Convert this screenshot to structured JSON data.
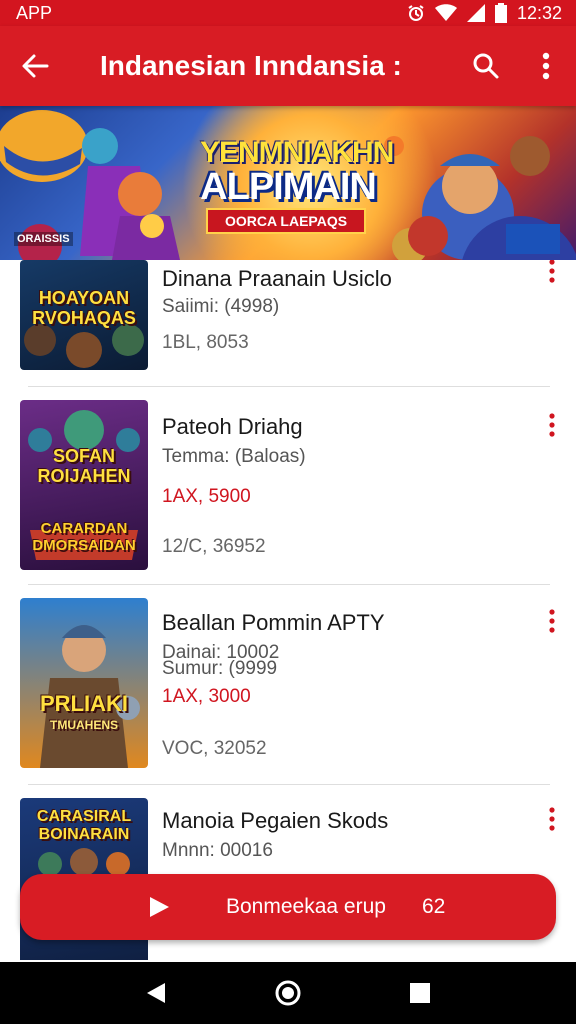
{
  "status_bar": {
    "app_label": "APP",
    "time": "12:32",
    "icons": [
      "alarm-icon",
      "wifi-icon",
      "signal-icon",
      "battery-icon"
    ]
  },
  "app_bar": {
    "title": "Indanesian Inndansia :",
    "icons": [
      "back-arrow-icon",
      "search-icon",
      "more-vert-icon"
    ]
  },
  "banner": {
    "headline_line1": "YENMNIAKHN",
    "headline_line2": "ALPIMAIN",
    "subtitle": "OORCA LAEPAQS",
    "corner_tag": "ORAISSIS"
  },
  "items": [
    {
      "name": "Dinana Praanain Usiclo",
      "meta": "Saiimi: (4998)",
      "price": "",
      "count": "1BL, 8053",
      "thumb_title": "HOAYOAN RVOHAQAS",
      "thumb_colors": [
        "#163a66",
        "#0b1b33"
      ]
    },
    {
      "name": "Pateoh Driahg",
      "meta": "Temma: (Baloas)",
      "price": "1AX, 5900",
      "count": "12/C, 36952",
      "thumb_title": "SOFAN ROIJAHEN",
      "thumb_title2": "CARARDAN DMORSAIDAN",
      "thumb_colors": [
        "#6b2d87",
        "#2a0f3d"
      ]
    },
    {
      "name": "Beallan Pommin APTY",
      "meta": "Dainai: 10002",
      "meta2": "Sumur: (9999",
      "price": "1AX, 3000",
      "count": "VOC, 32052",
      "thumb_title": "PRLIAKI",
      "thumb_title2": "TMUAHENS",
      "thumb_colors": [
        "#2e7fcf",
        "#e0881f"
      ]
    },
    {
      "name": "Manoia Pegaien Skods",
      "meta": "Mnnn: 00016",
      "price": "",
      "count": "",
      "thumb_title": "CARASIRAL BOINARAIN",
      "thumb_colors": [
        "#1b3a7a",
        "#0f1f40"
      ]
    }
  ],
  "install_button": {
    "label": "Bonmeekaa erup",
    "count": "62",
    "icon": "play-icon"
  },
  "nav_bar": {
    "icons": [
      "back-triangle-icon",
      "home-circle-icon",
      "recents-square-icon"
    ]
  },
  "colors": {
    "primary": "#d81c24",
    "price": "#d0151f"
  }
}
